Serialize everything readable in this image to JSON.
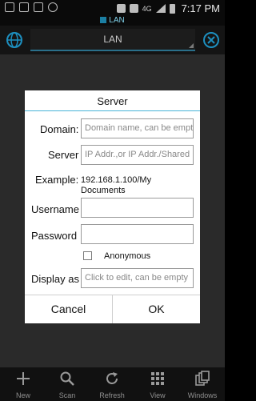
{
  "status_bar": {
    "network": "4G",
    "time": "7:17 PM",
    "icons": [
      "gallery-icon",
      "voicemail-icon",
      "camera-icon",
      "chat-icon",
      "mute-icon",
      "wifi-icon",
      "signal-icon",
      "battery-icon"
    ]
  },
  "app_tab": {
    "label": "LAN"
  },
  "actionbar": {
    "title": "LAN"
  },
  "dialog": {
    "title": "Server",
    "domain_label": "Domain:",
    "domain_placeholder": "Domain name, can be empty",
    "server_label": "Server",
    "server_placeholder": "IP Addr.,or IP Addr./Shared",
    "example_label": "Example:",
    "example_value_line1": "192.168.1.100/My",
    "example_value_line2": "Documents",
    "username_label": "Username",
    "username_value": "",
    "password_label": "Password",
    "password_value": "",
    "anonymous_label": "Anonymous",
    "anonymous_checked": false,
    "display_label": "Display as",
    "display_placeholder": "Click to edit, can be empty",
    "cancel_label": "Cancel",
    "ok_label": "OK"
  },
  "toolbar": {
    "items": [
      {
        "label": "New",
        "icon": "plus-icon"
      },
      {
        "label": "Scan",
        "icon": "search-icon"
      },
      {
        "label": "Refresh",
        "icon": "refresh-icon"
      },
      {
        "label": "View",
        "icon": "grid-icon"
      },
      {
        "label": "Windows",
        "icon": "windows-icon"
      }
    ]
  },
  "colors": {
    "accent": "#48b4d8",
    "dialog_bg": "#ffffff",
    "overlay": "#2a2a2a"
  }
}
